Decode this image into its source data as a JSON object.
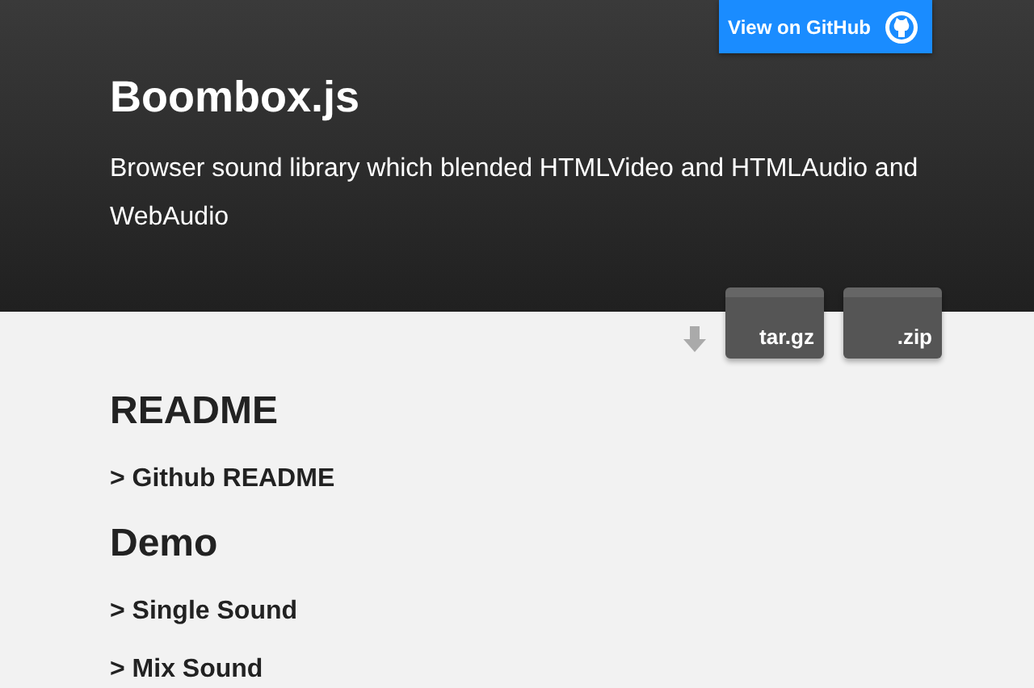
{
  "header": {
    "title": "Boombox.js",
    "description": "Browser sound library which blended HTMLVideo and HTMLAudio and WebAudio",
    "github_button": "View on GitHub",
    "downloads": [
      "tar.gz",
      ".zip"
    ]
  },
  "sections": [
    {
      "heading": "README",
      "links": [
        "> Github README"
      ]
    },
    {
      "heading": "Demo",
      "links": [
        "> Single Sound",
        "> Mix Sound"
      ]
    }
  ]
}
